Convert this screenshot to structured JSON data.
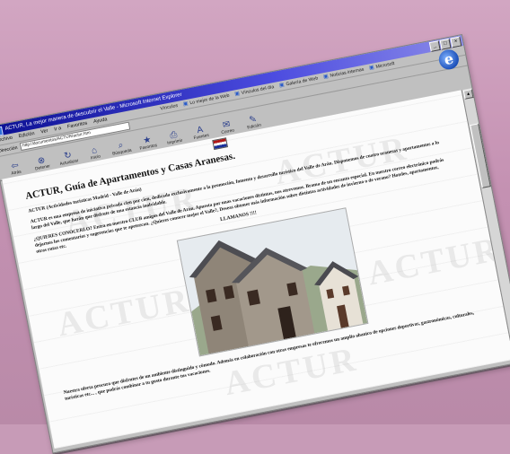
{
  "window": {
    "title": "ACTUR, La mejor manera de descubrir el Valle - Microsoft Internet Explorer",
    "controls": [
      "_",
      "□",
      "×"
    ]
  },
  "menu": [
    "Archivo",
    "Edición",
    "Ver",
    "Ir a",
    "Favoritos",
    "Ayuda"
  ],
  "links_bar": {
    "label": "Vínculos",
    "items": [
      "Lo mejor de la Web",
      "Vínculos del día",
      "Galería de Web",
      "Noticias internas",
      "Microsoft"
    ]
  },
  "address": {
    "label": "Dirección",
    "value": "http://documentos/ACTUR/actur.htm"
  },
  "toolbar": [
    {
      "label": "Atrás",
      "icon": "back-arrow-icon"
    },
    {
      "label": "Detener",
      "icon": "stop-icon"
    },
    {
      "label": "Actualizar",
      "icon": "refresh-icon"
    },
    {
      "label": "Inicio",
      "icon": "home-icon"
    },
    {
      "label": "Búsqueda",
      "icon": "search-icon"
    },
    {
      "label": "Favoritos",
      "icon": "favorites-icon"
    },
    {
      "label": "Imprimir",
      "icon": "print-icon"
    },
    {
      "label": "Fuentes",
      "icon": "font-icon"
    },
    {
      "label": "Correo",
      "icon": "mail-icon"
    },
    {
      "label": "Edición",
      "icon": "edit-icon"
    }
  ],
  "page": {
    "heading": "ACTUR, Guía de Apartamentos y Casas Aranesas.",
    "p1": "ACTUR (Actividades turísticas Madrid - Valle de Arán)",
    "p2": "ACTUR es una empresa de iniciativa privada cien por cien, dedicada exclusivamente a la promoción, fomento y desarrollo turístico del Valle de Arán. Disponemos de cuatro oranesas y apartamentos a lo largo del Valle, que harán que disfrute de una estancia inolvidable.",
    "p3": "¿QUIERES CONOCERLO? Entra en nuestro CLUB amigos del Valle de Arán. Apuesta por unas vacaciones distintas, nos atrevemos. Brama de un encanto especial. En nuestro correo electrónico podrás dejarnos los comentarios y sugerencias que te apetezcan. ¿Quieres conocer mejor el Valle?, Deseas obtener más información sobre distintas actividades de invierno o de verano? Hoteles, apartamentos, otras rutas etc.",
    "call": "LLAMANOS !!!!",
    "p4": "Nuestra oferta procura que disfrutes de un ambiente distinguido y cómodo. Además en colaboración con otras empresas te ofrecemos un amplio abanico de opciones deportivas, gastronómicas, culturales, turísticas etc... , que podrás combinar a tu gusto durante tus vacaciones.",
    "watermark": "ACTUR"
  }
}
